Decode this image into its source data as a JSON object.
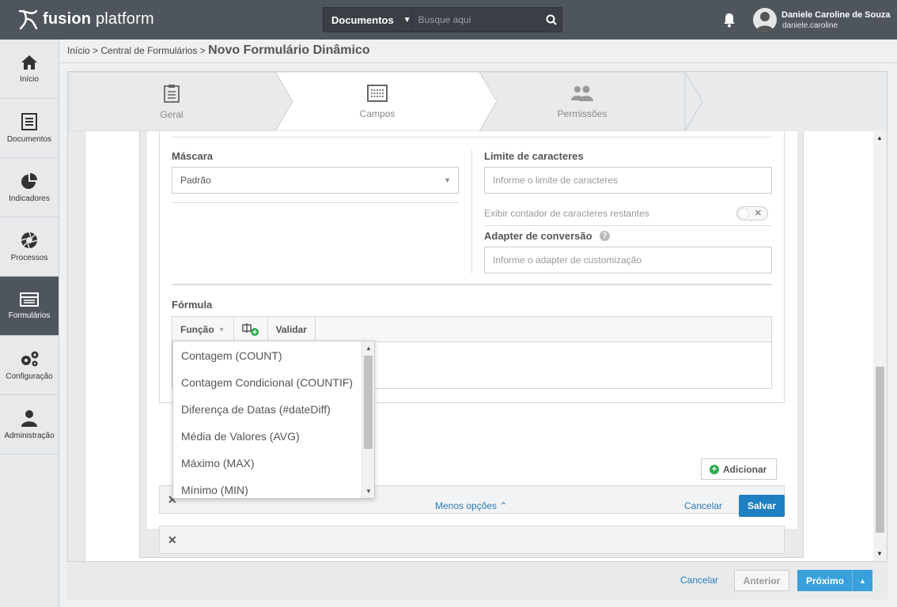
{
  "topbar": {
    "brand_bold": "fusion",
    "brand_light": "platform",
    "search_scope": "Documentos",
    "search_placeholder": "Busque aqui",
    "user_name": "Daniele Caroline de Souza",
    "user_login": "daniele.caroline"
  },
  "sidebar": {
    "items": [
      {
        "label": "Início",
        "icon": "home-icon"
      },
      {
        "label": "Documentos",
        "icon": "document-icon"
      },
      {
        "label": "Indicadores",
        "icon": "pie-chart-icon"
      },
      {
        "label": "Processos",
        "icon": "aperture-icon"
      },
      {
        "label": "Formulários",
        "icon": "form-icon",
        "active": true
      },
      {
        "label": "Configuração",
        "icon": "gears-icon"
      },
      {
        "label": "Administração",
        "icon": "user-icon"
      }
    ]
  },
  "breadcrumb": {
    "home": "Início",
    "sep": ">",
    "parent": "Central de Formulários",
    "current": "Novo Formulário Dinâmico"
  },
  "steps": [
    {
      "label": "Geral",
      "icon": "clipboard-icon"
    },
    {
      "label": "Campos",
      "icon": "fields-icon",
      "active": true
    },
    {
      "label": "Permissões",
      "icon": "users-icon"
    }
  ],
  "form": {
    "mask_label": "Máscara",
    "mask_value": "Padrão",
    "limit_label": "Limite de caracteres",
    "limit_placeholder": "Informe o limite de caracteres",
    "counter_label": "Exibir contador de caracteres restantes",
    "toggle_off": "✕",
    "adapter_label": "Adapter de conversão",
    "adapter_placeholder": "Informe o adapter de customização",
    "help": "?",
    "formula_label": "Fórmula",
    "toolbar_function": "Função",
    "toolbar_validate": "Validar",
    "collapse_glyph": "✕",
    "add_label": "Adicionar",
    "less_options": "Menos opções",
    "cancel": "Cancelar",
    "save": "Salvar"
  },
  "dropdown": {
    "items": [
      "Contagem (COUNT)",
      "Contagem Condicional (COUNTIF)",
      "Diferença de Datas (#dateDiff)",
      "Média de Valores (AVG)",
      "Máximo (MAX)",
      "Mínimo (MIN)"
    ]
  },
  "footer": {
    "cancel": "Cancelar",
    "previous": "Anterior",
    "next": "Próximo"
  },
  "colors": {
    "topbar": "#4f555c",
    "primary": "#1e7fc1",
    "next": "#3aa0dc",
    "add_green": "#2eaa4d"
  }
}
